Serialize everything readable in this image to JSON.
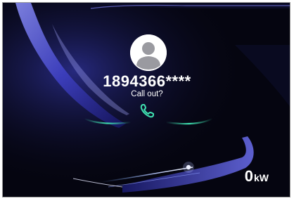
{
  "call_screen": {
    "caller_number": "1894366****",
    "prompt": "Call out?",
    "avatar_icon": "contact-avatar-icon",
    "call_icon": "phone-handset-icon",
    "accent_color": "#3fe0b0"
  },
  "power_meter": {
    "value": "0",
    "unit": "kW"
  },
  "theme": {
    "background": "#050510",
    "ribbon_color": "#4b4ce0"
  }
}
